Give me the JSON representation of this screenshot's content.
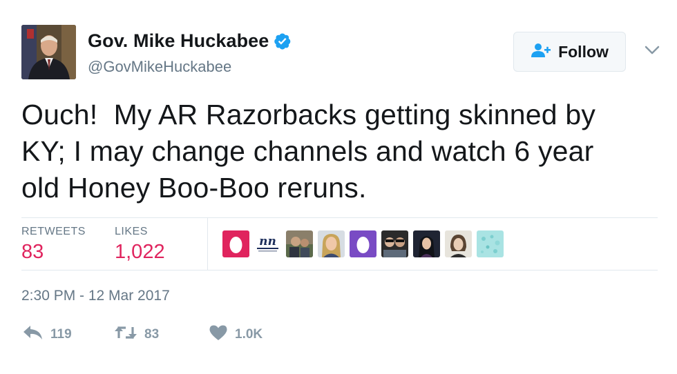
{
  "author": {
    "display_name": "Gov. Mike Huckabee",
    "handle": "@GovMikeHuckabee",
    "verified": true,
    "verified_color": "#1da1f2"
  },
  "follow_button": {
    "label": "Follow",
    "icon": "add-user-icon"
  },
  "menu": {
    "icon": "chevron-down-icon"
  },
  "tweet": {
    "text": "Ouch!  My AR Razorbacks getting skinned by\nKY; I may change channels and watch 6 year\nold Honey Boo-Boo reruns."
  },
  "stats": {
    "retweets_label": "RETWEETS",
    "retweets_value": "83",
    "likes_label": "LIKES",
    "likes_value": "1,022",
    "value_color": "#e0245e"
  },
  "liker_avatars": [
    {
      "kind": "egg",
      "color": "#e0245e"
    },
    {
      "kind": "logo",
      "text": "nn"
    },
    {
      "kind": "photo"
    },
    {
      "kind": "photo"
    },
    {
      "kind": "egg",
      "color": "#794bc4"
    },
    {
      "kind": "photo"
    },
    {
      "kind": "photo"
    },
    {
      "kind": "photo"
    },
    {
      "kind": "pattern"
    }
  ],
  "timestamp": "2:30 PM - 12 Mar 2017",
  "actions": {
    "reply": {
      "icon": "reply-icon",
      "count": "119"
    },
    "retweet": {
      "icon": "retweet-icon",
      "count": "83"
    },
    "like": {
      "icon": "heart-icon",
      "count": "1.0K"
    }
  }
}
